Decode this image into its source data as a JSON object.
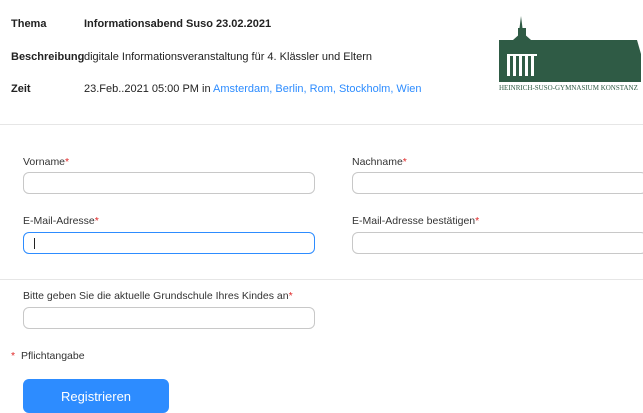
{
  "info": {
    "thema_label": "Thema",
    "thema_value": "Informationsabend Suso 23.02.2021",
    "beschreibung_label": "Beschreibung",
    "beschreibung_value": "digitale Informationsveranstaltung für 4. Klässler und Eltern",
    "zeit_label": "Zeit",
    "zeit_value": "23.Feb..2021 05:00 PM in ",
    "zeit_link": "Amsterdam, Berlin, Rom, Stockholm, Wien"
  },
  "logo": {
    "text": "HEINRICH-SUSO-GYMNASIUM KONSTANZ",
    "color": "#2f5b45"
  },
  "form": {
    "vorname_label": "Vorname",
    "nachname_label": "Nachname",
    "email_label": "E-Mail-Adresse",
    "email_confirm_label": "E-Mail-Adresse bestätigen",
    "grundschule_label": "Bitte geben Sie die aktuelle Grundschule Ihres Kindes an",
    "required_marker": "*",
    "vorname_value": "",
    "nachname_value": "",
    "email_value": "",
    "email_confirm_value": "",
    "grundschule_value": ""
  },
  "pflicht_text": "Pflichtangabe",
  "submit_label": "Registrieren",
  "colors": {
    "accent": "#2d8cff",
    "required": "#e02828"
  }
}
